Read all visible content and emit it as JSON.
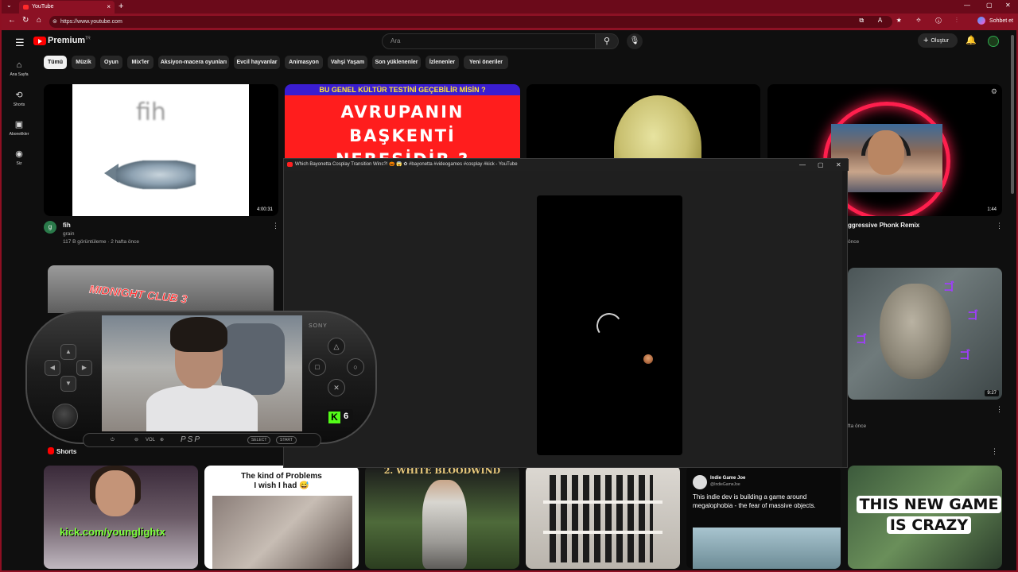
{
  "browser": {
    "tab_title": "YouTube",
    "url": "https://www.youtube.com",
    "chat_button": "Sohbet et",
    "new_tab": "+",
    "close": "×"
  },
  "header": {
    "logo": "Premium",
    "logo_region": "TR",
    "search_placeholder": "Ara",
    "create_label": "Oluştur"
  },
  "sidebar": {
    "items": [
      {
        "label": "Ana Sayfa",
        "icon": "home-icon"
      },
      {
        "label": "Shorts",
        "icon": "shorts-icon"
      },
      {
        "label": "Abonelikler",
        "icon": "subscriptions-icon"
      },
      {
        "label": "Siz",
        "icon": "you-icon"
      }
    ]
  },
  "chips": [
    "Tümü",
    "Müzik",
    "Oyun",
    "Mix'ler",
    "Aksiyon-macera oyunları",
    "Evcil hayvanlar",
    "Animasyon",
    "Vahşi Yaşam",
    "Son yüklenenler",
    "İzlenenler",
    "Yeni öneriler"
  ],
  "videos": {
    "v1": {
      "thumb_text": "fih",
      "duration": "4:00:31",
      "title": "fih",
      "channel": "grain",
      "meta": "117 B görüntüleme · 2 hafta önce",
      "avatar_letter": "g"
    },
    "v2": {
      "banner": "BU GENEL KÜLTÜR TESTİNİ GEÇEBİLİR MİSİN ?",
      "line1": "AVRUPANIN BAŞKENTİ",
      "line2": "NERESİDİR ?"
    },
    "v4": {
      "duration": "1:44",
      "title": "ggressive Phonk Remix",
      "meta": "önce"
    },
    "v5": {
      "thumb_text": "MIDNIGHT CLUB 3"
    },
    "v6": {
      "duration": "9:27",
      "meta": "fta önce"
    }
  },
  "popup": {
    "title": "Which Bayonetta Cosplay Transition Wins?! 🎃 😱 ✿ #bayonetta #videogames #cosplay #kick - YouTube"
  },
  "psp": {
    "brand": "SONY",
    "vol": "VOL",
    "psp_logo": "PSP",
    "select": "SELECT",
    "start": "START",
    "viewer_count": "6",
    "kick_letter": "K"
  },
  "shorts": {
    "label": "Shorts",
    "s1_text": "kick.com/younglightx",
    "s2_caption_1": "The kind of Problems",
    "s2_caption_2": "I wish I had 😅",
    "s3_caption": "2. WHITE BLOODWIND",
    "s5_name": "Indie Game Joe",
    "s5_handle": "@IndieGameJoe",
    "s5_text": "This indie dev is building a game around megalophobia - the fear of massive objects.",
    "s6_line1": "THIS NEW GAME",
    "s6_line2": "IS CRAZY"
  },
  "colors": {
    "browser_accent": "#8c1124",
    "yt_red": "#ff0000",
    "kick_green": "#53fc18"
  }
}
